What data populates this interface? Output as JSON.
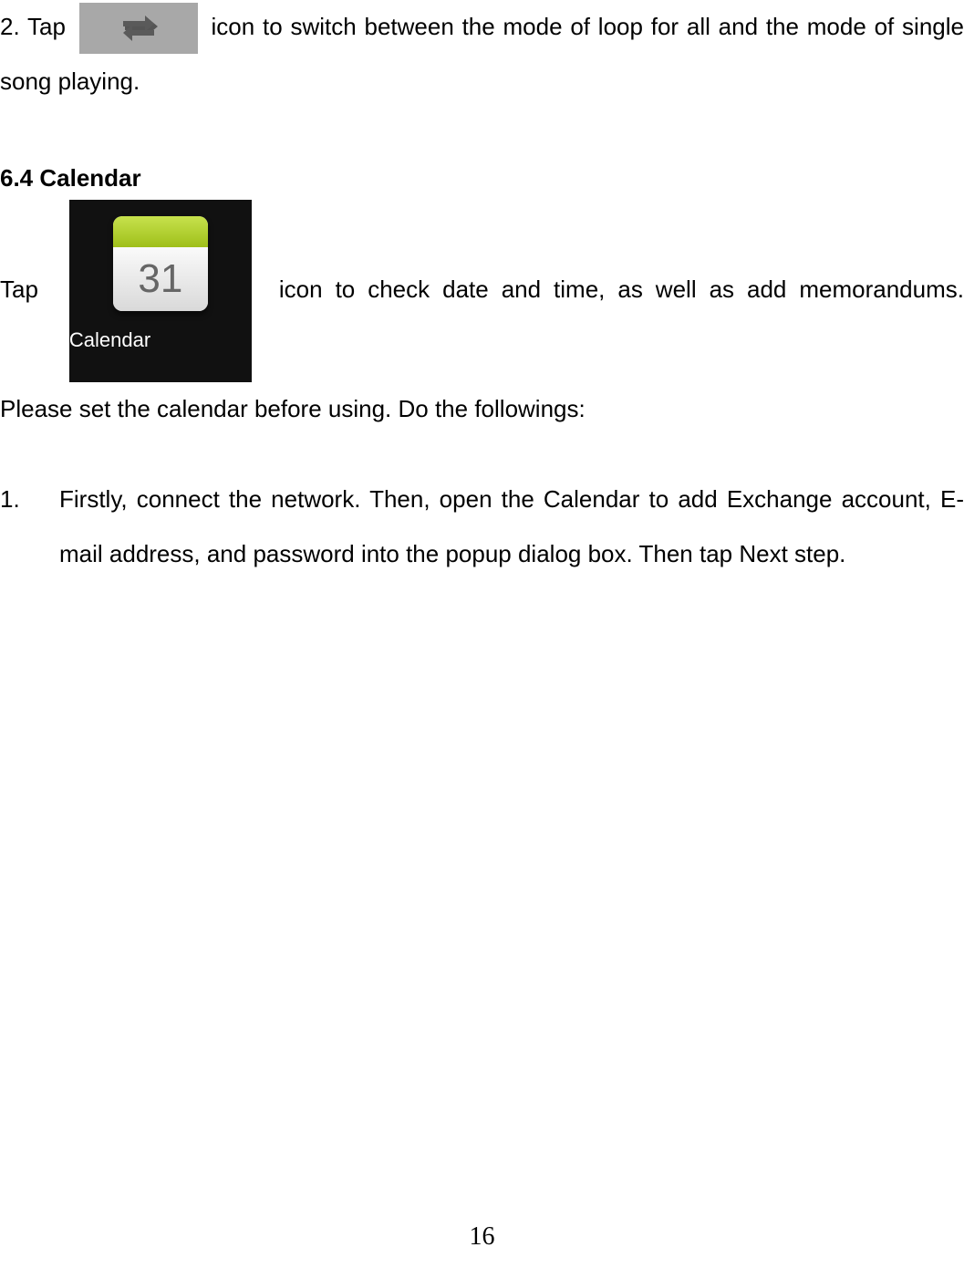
{
  "para1": {
    "before_icon": "2. Tap",
    "after_icon": " icon to switch between the mode of loop for all and the mode of single song playing."
  },
  "section_heading": "6.4 Calendar",
  "calendar_icon": {
    "day": "31",
    "label": "Calendar"
  },
  "calendar_para": {
    "before_icon": "Tap",
    "after_icon": " icon to check date and time, as well as add memorandums. Please set the calendar before using. Do the followings:"
  },
  "list": {
    "num": "1.",
    "body": "Firstly, connect the network. Then, open the Calendar to add Exchange account, E-mail address, and password into the popup dialog box. Then tap Next step."
  },
  "page_number": "16"
}
